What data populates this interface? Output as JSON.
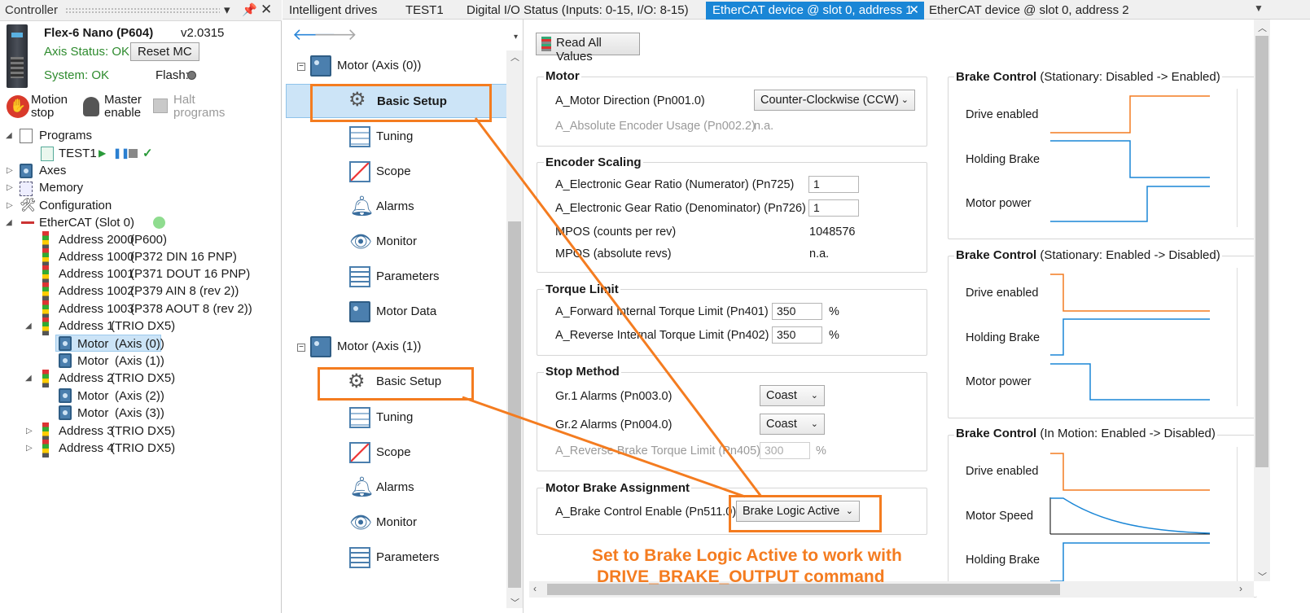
{
  "controller_panel": {
    "title": "Controller",
    "device_name": "Flex-6 Nano (P604)",
    "version": "v2.0315",
    "axis_status": "Axis Status: OK",
    "reset_button": "Reset MC",
    "system_status": "System: OK",
    "flash_label": "Flash:",
    "motion_stop": [
      "Motion",
      "stop"
    ],
    "master_enable": [
      "Master",
      "enable"
    ],
    "halt_programs": [
      "Halt",
      "programs"
    ],
    "tree": {
      "programs": "Programs",
      "test1": "TEST1",
      "axes": "Axes",
      "memory": "Memory",
      "configuration": "Configuration",
      "ethercat": "EtherCAT (Slot 0)",
      "addr2000": [
        "Address 2000",
        "(P600)"
      ],
      "addr1000": [
        "Address 1000",
        "(P372 DIN 16 PNP)"
      ],
      "addr1001": [
        "Address 1001",
        "(P371 DOUT 16 PNP)"
      ],
      "addr1002": [
        "Address 1002",
        "(P379 AIN 8 (rev 2))"
      ],
      "addr1003": [
        "Address 1003",
        "(P378 AOUT 8 (rev 2))"
      ],
      "addr1": [
        "Address 1",
        "(TRIO DX5)"
      ],
      "motor0": [
        "Motor",
        "(Axis (0))"
      ],
      "motor1": [
        "Motor",
        "(Axis (1))"
      ],
      "addr2": [
        "Address 2",
        "(TRIO DX5)"
      ],
      "motor2": [
        "Motor",
        "(Axis (2))"
      ],
      "motor3": [
        "Motor",
        "(Axis (3))"
      ],
      "addr3": [
        "Address 3",
        "(TRIO DX5)"
      ],
      "addr4": [
        "Address 4",
        "(TRIO DX5)"
      ]
    }
  },
  "tabs": [
    "Intelligent drives",
    "TEST1",
    "Digital I/O Status (Inputs: 0-15,  I/O: 8-15)",
    "EtherCAT device @ slot 0, address 1",
    "EtherCAT device @ slot 0, address 2"
  ],
  "axis_tree": {
    "motor0": "Motor (Axis (0))",
    "motor1": "Motor (Axis (1))",
    "items": [
      "Basic Setup",
      "Tuning",
      "Scope",
      "Alarms",
      "Monitor",
      "Parameters",
      "Motor Data"
    ]
  },
  "content": {
    "read_all": "Read All Values",
    "motor": {
      "title": "Motor",
      "direction_label": "A_Motor Direction (Pn001.0)",
      "direction_value": "Counter-Clockwise (CCW)",
      "encoder_label": "A_Absolute Encoder Usage (Pn002.2)",
      "encoder_value": "n.a."
    },
    "encoder_scaling": {
      "title": "Encoder Scaling",
      "num_label": "A_Electronic Gear Ratio (Numerator) (Pn725)",
      "num_value": "1",
      "den_label": "A_Electronic Gear Ratio (Denominator) (Pn726)",
      "den_value": "1",
      "mpos_label": "MPOS (counts per rev)",
      "mpos_value": "1048576",
      "mpos_abs_label": "MPOS (absolute revs)",
      "mpos_abs_value": "n.a."
    },
    "torque_limit": {
      "title": "Torque Limit",
      "fwd_label": "A_Forward Internal Torque Limit (Pn401)",
      "fwd_value": "350",
      "rev_label": "A_Reverse Internal Torque Limit (Pn402)",
      "rev_value": "350",
      "unit": "%"
    },
    "stop_method": {
      "title": "Stop Method",
      "gr1_label": "Gr.1 Alarms (Pn003.0)",
      "gr1_value": "Coast",
      "gr2_label": "Gr.2 Alarms (Pn004.0)",
      "gr2_value": "Coast",
      "rev_brake_label": "A_Reverse Brake Torque Limit (Pn405)",
      "rev_brake_value": "300",
      "unit": "%"
    },
    "brake_assign": {
      "title": "Motor Brake Assignment",
      "label": "A_Brake Control Enable (Pn511.0)",
      "value": "Brake Logic Active"
    },
    "annotation": [
      "Set to Brake Logic Active to work with",
      "DRIVE_BRAKE_OUTPUT command"
    ]
  },
  "brake_panels": [
    {
      "title": "Brake Control",
      "subtitle": "(Stationary: Disabled -> Enabled)",
      "rows": [
        "Drive enabled",
        "Holding Brake",
        "Motor power"
      ]
    },
    {
      "title": "Brake Control",
      "subtitle": "(Stationary: Enabled -> Disabled)",
      "rows": [
        "Drive enabled",
        "Holding Brake",
        "Motor power"
      ]
    },
    {
      "title": "Brake Control",
      "subtitle": "(In Motion: Enabled -> Disabled)",
      "rows": [
        "Drive enabled",
        "Motor Speed",
        "Holding Brake"
      ]
    }
  ],
  "colors": {
    "accent": "#1a86d6",
    "annotation": "#f47c20",
    "signal_orange": "#f47c20",
    "signal_blue": "#1a86d6"
  }
}
